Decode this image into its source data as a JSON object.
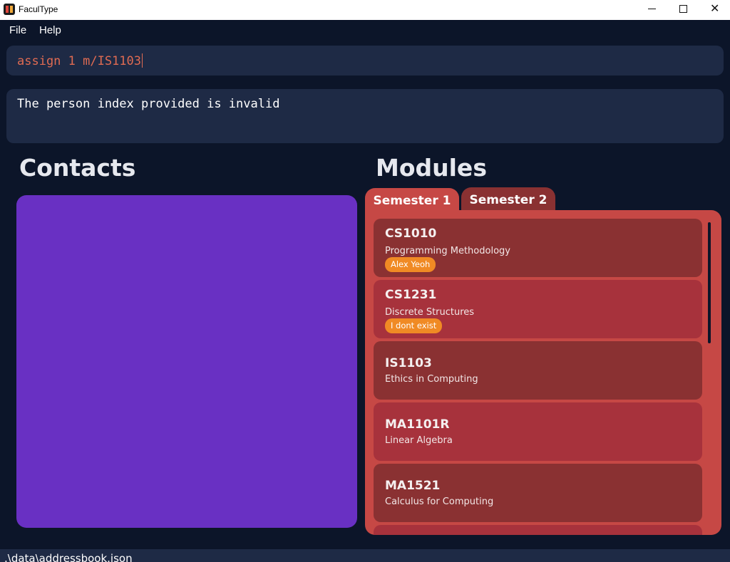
{
  "window": {
    "title": "FaculType",
    "close_glyph": "✕"
  },
  "menu": {
    "file": "File",
    "help": "Help"
  },
  "command": {
    "value": "assign 1 m/IS1103"
  },
  "result": {
    "text": "The person index provided is invalid"
  },
  "contacts": {
    "heading": "Contacts"
  },
  "modules": {
    "heading": "Modules",
    "tabs": [
      "Semester 1",
      "Semester 2"
    ],
    "active_tab": "Semester 1",
    "items": [
      {
        "code": "CS1010",
        "name": "Programming Methodology",
        "tag": "Alex Yeoh"
      },
      {
        "code": "CS1231",
        "name": "Discrete Structures",
        "tag": "I dont exist"
      },
      {
        "code": "IS1103",
        "name": "Ethics in Computing"
      },
      {
        "code": "MA1101R",
        "name": "Linear Algebra"
      },
      {
        "code": "MA1521",
        "name": "Calculus for Computing"
      }
    ]
  },
  "status": {
    "path": ".\\data\\addressbook.json"
  },
  "colors": {
    "background": "#0c1529",
    "box": "#1e2a45",
    "contacts_panel": "#6930c3",
    "modules_panel": "#c64845",
    "card_dark": "#8a3132",
    "card_light": "#a7323c",
    "tag": "#f08a24",
    "command_text": "#e06b52"
  },
  "icons": {
    "app": "faculty-app-icon",
    "minimize": "minimize-icon",
    "maximize": "maximize-icon",
    "close": "close-icon"
  }
}
